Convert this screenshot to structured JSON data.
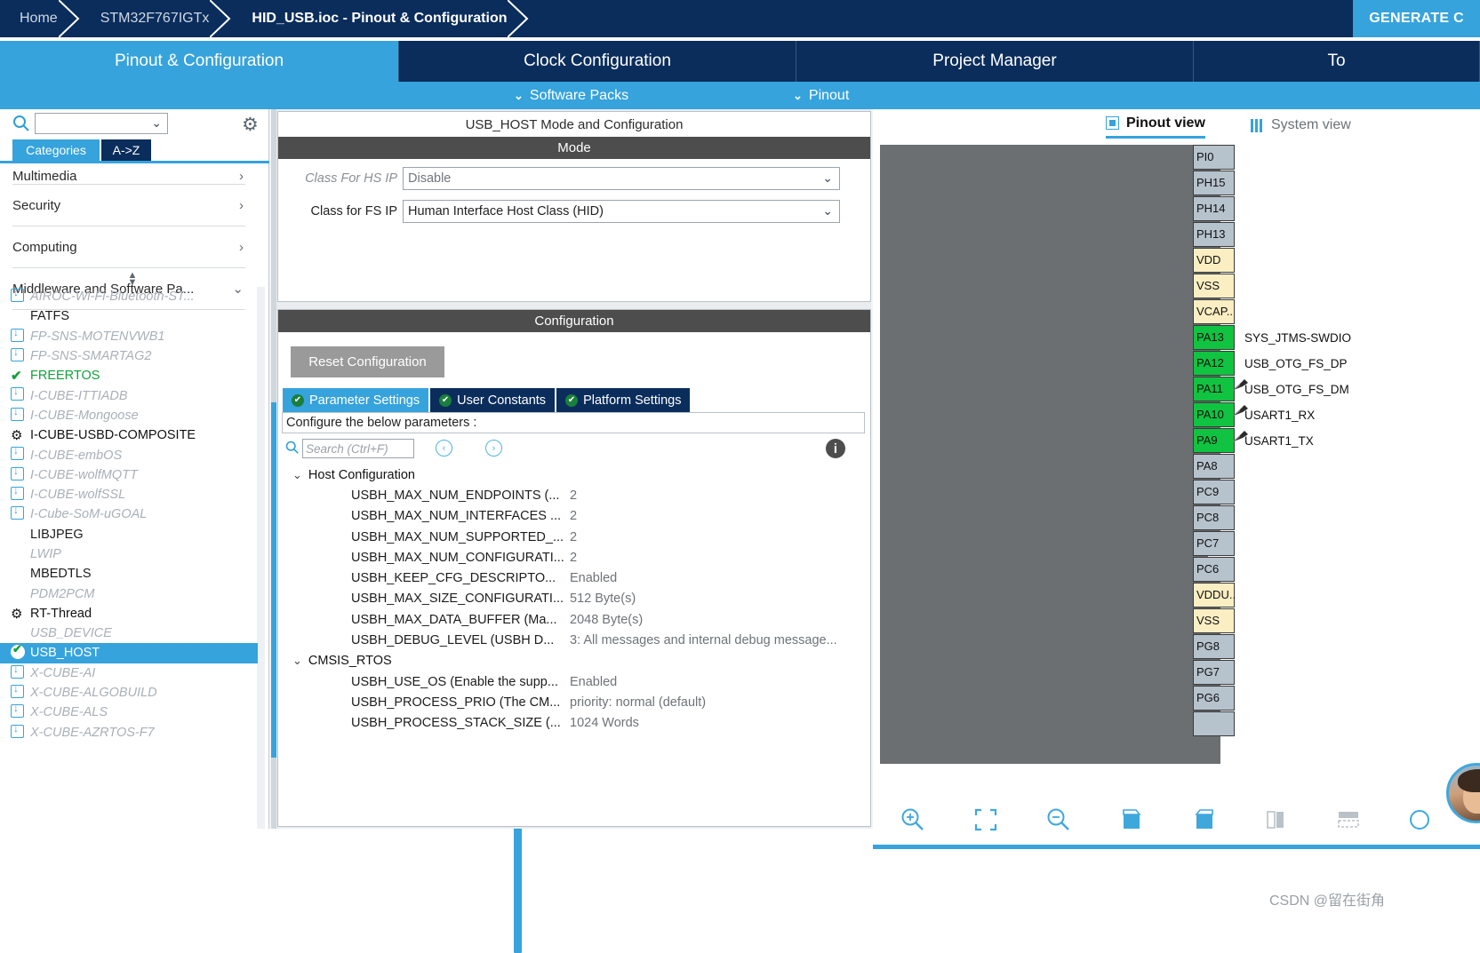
{
  "breadcrumb": {
    "items": [
      {
        "label": "Home",
        "active": false
      },
      {
        "label": "STM32F767IGTx",
        "active": false
      },
      {
        "label": "HID_USB.ioc - Pinout & Configuration",
        "active": true
      }
    ],
    "generate_code_label": "GENERATE C"
  },
  "main_tabs": [
    {
      "label": "Pinout & Configuration",
      "selected": true
    },
    {
      "label": "Clock Configuration",
      "selected": false
    },
    {
      "label": "Project Manager",
      "selected": false
    },
    {
      "label": "To",
      "selected": false
    }
  ],
  "sub_bar": {
    "software_packs": "Software Packs",
    "pinout": "Pinout",
    "caret": "⌄"
  },
  "left_panel": {
    "search_value": "",
    "gear_icon": "gear-icon",
    "tabs": [
      {
        "label": "Categories",
        "selected": true
      },
      {
        "label": "A->Z",
        "selected": false
      }
    ],
    "categories": [
      {
        "label": "Multimedia",
        "arrow": "›",
        "clipped": true
      },
      {
        "label": "Security",
        "arrow": "›",
        "clipped": false
      },
      {
        "label": "Computing",
        "arrow": "›",
        "clipped": false
      },
      {
        "label": "Middleware and Software Pa...",
        "arrow": "⌄",
        "clipped": false
      }
    ],
    "ip_items": [
      {
        "label": "AIROC-Wi-Fi-Bluetooth-ST...",
        "icon": "download-icon",
        "state": "dim"
      },
      {
        "label": "FATFS",
        "icon": "none",
        "state": "plain"
      },
      {
        "label": "FP-SNS-MOTENVWB1",
        "icon": "download-icon",
        "state": "dim"
      },
      {
        "label": "FP-SNS-SMARTAG2",
        "icon": "download-icon",
        "state": "dim"
      },
      {
        "label": "FREERTOS",
        "icon": "check-icon",
        "state": "green"
      },
      {
        "label": "I-CUBE-ITTIADB",
        "icon": "download-icon",
        "state": "dim"
      },
      {
        "label": "I-CUBE-Mongoose",
        "icon": "download-icon",
        "state": "dim"
      },
      {
        "label": "I-CUBE-USBD-COMPOSITE",
        "icon": "gear-icon",
        "state": "bold"
      },
      {
        "label": "I-CUBE-embOS",
        "icon": "download-icon",
        "state": "dim"
      },
      {
        "label": "I-CUBE-wolfMQTT",
        "icon": "download-icon",
        "state": "dim"
      },
      {
        "label": "I-CUBE-wolfSSL",
        "icon": "download-icon",
        "state": "dim"
      },
      {
        "label": "I-Cube-SoM-uGOAL",
        "icon": "download-icon",
        "state": "dim"
      },
      {
        "label": "LIBJPEG",
        "icon": "none",
        "state": "plain"
      },
      {
        "label": "LWIP",
        "icon": "none",
        "state": "dim"
      },
      {
        "label": "MBEDTLS",
        "icon": "none",
        "state": "plain"
      },
      {
        "label": "PDM2PCM",
        "icon": "none",
        "state": "dim"
      },
      {
        "label": "RT-Thread",
        "icon": "gear-icon",
        "state": "bold"
      },
      {
        "label": "USB_DEVICE",
        "icon": "none",
        "state": "dim"
      },
      {
        "label": "USB_HOST",
        "icon": "circle-check-icon",
        "state": "sel"
      },
      {
        "label": "X-CUBE-AI",
        "icon": "download-icon",
        "state": "dim"
      },
      {
        "label": "X-CUBE-ALGOBUILD",
        "icon": "download-icon",
        "state": "dim"
      },
      {
        "label": "X-CUBE-ALS",
        "icon": "download-icon",
        "state": "dim"
      },
      {
        "label": "X-CUBE-AZRTOS-F7",
        "icon": "download-icon",
        "state": "dim"
      }
    ]
  },
  "center_panel": {
    "mode_title": "USB_HOST Mode and Configuration",
    "mode_header": "Mode",
    "mode_rows": [
      {
        "label": "Class For HS IP",
        "value": "Disable",
        "disabled": true
      },
      {
        "label": "Class for FS IP",
        "value": "Human Interface Host Class (HID)",
        "disabled": false
      }
    ],
    "config_header": "Configuration",
    "reset_button": "Reset Configuration",
    "config_tabs": [
      {
        "label": "Parameter Settings",
        "selected": true
      },
      {
        "label": "User Constants",
        "selected": false
      },
      {
        "label": "Platform Settings",
        "selected": false
      }
    ],
    "instruction": "Configure the below parameters :",
    "search_placeholder": "Search (Ctrl+F)",
    "search_value": "",
    "prev_icon": "chevron-left-circle-icon",
    "next_icon": "chevron-right-circle-icon",
    "info_icon": "info-icon",
    "param_groups": [
      {
        "name": "Host Configuration",
        "expanded": true,
        "rows": [
          {
            "name": "USBH_MAX_NUM_ENDPOINTS (...",
            "value": "2"
          },
          {
            "name": "USBH_MAX_NUM_INTERFACES ...",
            "value": "2"
          },
          {
            "name": "USBH_MAX_NUM_SUPPORTED_...",
            "value": "2"
          },
          {
            "name": "USBH_MAX_NUM_CONFIGURATI...",
            "value": "2"
          },
          {
            "name": "USBH_KEEP_CFG_DESCRIPTO...",
            "value": "Enabled"
          },
          {
            "name": "USBH_MAX_SIZE_CONFIGURATI...",
            "value": "512 Byte(s)"
          },
          {
            "name": "USBH_MAX_DATA_BUFFER (Ma...",
            "value": "2048 Byte(s)"
          },
          {
            "name": "USBH_DEBUG_LEVEL (USBH D...",
            "value": "3: All messages and internal debug message..."
          }
        ]
      },
      {
        "name": "CMSIS_RTOS",
        "expanded": true,
        "rows": [
          {
            "name": "USBH_USE_OS (Enable the supp...",
            "value": "Enabled"
          },
          {
            "name": "USBH_PROCESS_PRIO (The CM...",
            "value": "priority: normal (default)"
          },
          {
            "name": "USBH_PROCESS_STACK_SIZE (...",
            "value": "1024 Words"
          }
        ]
      }
    ]
  },
  "right_panel": {
    "view_tabs": [
      {
        "label": "Pinout view",
        "selected": true,
        "icon": "chip-icon"
      },
      {
        "label": "System view",
        "selected": false,
        "icon": "system-icon"
      }
    ],
    "pins": [
      {
        "name": "PI0",
        "color": "gray",
        "signal": ""
      },
      {
        "name": "PH15",
        "color": "gray",
        "signal": ""
      },
      {
        "name": "PH14",
        "color": "gray",
        "signal": ""
      },
      {
        "name": "PH13",
        "color": "gray",
        "signal": ""
      },
      {
        "name": "VDD",
        "color": "yellow",
        "signal": ""
      },
      {
        "name": "VSS",
        "color": "yellow",
        "signal": ""
      },
      {
        "name": "VCAP..",
        "color": "yellow",
        "signal": ""
      },
      {
        "name": "PA13",
        "color": "green",
        "signal": "SYS_JTMS-SWDIO"
      },
      {
        "name": "PA12",
        "color": "green",
        "signal": "USB_OTG_FS_DP"
      },
      {
        "name": "PA11",
        "color": "green",
        "signal": "USB_OTG_FS_DM",
        "pinned": true
      },
      {
        "name": "PA10",
        "color": "green",
        "signal": "USART1_RX",
        "pinned": true
      },
      {
        "name": "PA9",
        "color": "green",
        "signal": "USART1_TX",
        "pinned": true
      },
      {
        "name": "PA8",
        "color": "gray",
        "signal": ""
      },
      {
        "name": "PC9",
        "color": "gray",
        "signal": ""
      },
      {
        "name": "PC8",
        "color": "gray",
        "signal": ""
      },
      {
        "name": "PC7",
        "color": "gray",
        "signal": ""
      },
      {
        "name": "PC6",
        "color": "gray",
        "signal": ""
      },
      {
        "name": "VDDU..",
        "color": "yellow",
        "signal": ""
      },
      {
        "name": "VSS",
        "color": "yellow",
        "signal": ""
      },
      {
        "name": "PG8",
        "color": "gray",
        "signal": ""
      },
      {
        "name": "PG7",
        "color": "gray",
        "signal": ""
      },
      {
        "name": "PG6",
        "color": "gray",
        "signal": ""
      },
      {
        "name": "",
        "color": "gray",
        "signal": ""
      }
    ],
    "toolbar": [
      {
        "name": "zoom-in-icon"
      },
      {
        "name": "fit-to-screen-icon"
      },
      {
        "name": "zoom-out-icon"
      },
      {
        "name": "rotate-right-icon"
      },
      {
        "name": "rotate-left-icon"
      },
      {
        "name": "split-view-icon"
      },
      {
        "name": "layout-icon"
      },
      {
        "name": "more-icon"
      }
    ]
  },
  "watermark": "CSDN @留在街角",
  "colors": {
    "brand_dark": "#0a2d5c",
    "brand_blue": "#36a3dc",
    "panel_header": "#4d4d4d",
    "pin_green": "#10c341",
    "pin_yellow": "#faeec2",
    "pin_gray": "#b6c2cc"
  }
}
